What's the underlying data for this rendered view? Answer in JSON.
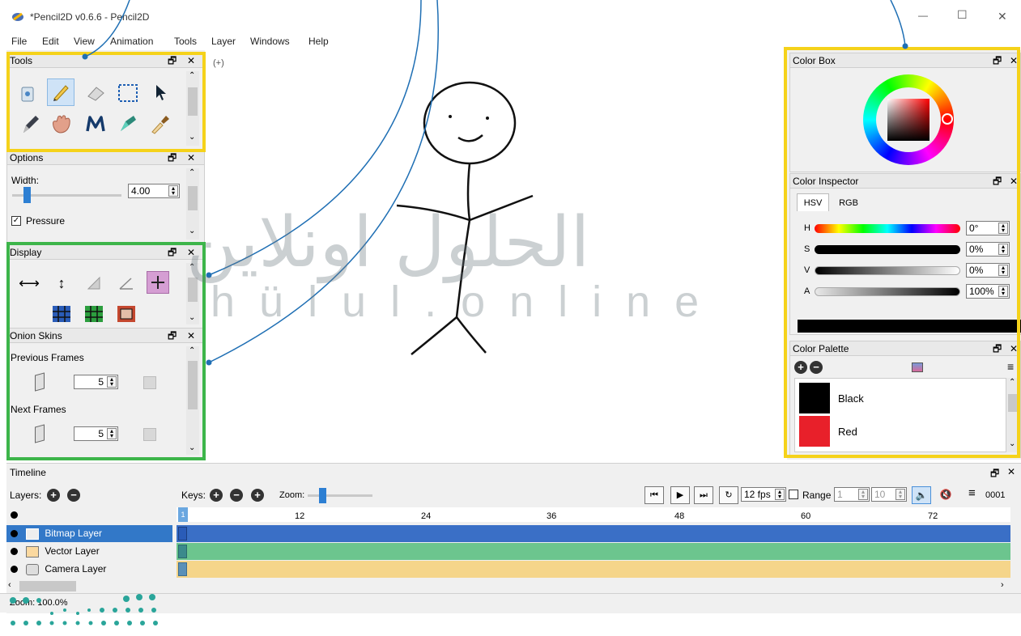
{
  "window": {
    "title": "*Pencil2D v0.6.6 - Pencil2D",
    "min_glyph": "—",
    "max_glyph": "☐",
    "close_glyph": "✕"
  },
  "menu": [
    "File",
    "Edit",
    "View",
    "Animation",
    "Tools",
    "Layer",
    "Windows",
    "Help"
  ],
  "tools_panel": {
    "title": "Tools",
    "icons": [
      "clear-icon",
      "pencil-icon",
      "eraser-icon",
      "select-icon",
      "move-icon",
      "pen-icon",
      "hand-icon",
      "polyline-icon",
      "bucket-icon",
      "eyedropper-icon"
    ]
  },
  "options_panel": {
    "title": "Options",
    "width_label": "Width:",
    "width_value": "4.00",
    "pressure_label": "Pressure",
    "pressure_checked": true
  },
  "display_panel": {
    "title": "Display",
    "icons": [
      "flip-horizontal-icon",
      "flip-vertical-icon",
      "overlay-icon",
      "angle-icon",
      "center-cross-icon",
      "grid-blue-icon",
      "grid-green-icon",
      "frame-icon"
    ]
  },
  "onion_panel": {
    "title": "Onion Skins",
    "previous_label": "Previous Frames",
    "previous_value": "5",
    "next_label": "Next Frames",
    "next_value": "5"
  },
  "color_box": {
    "title": "Color Box"
  },
  "color_inspector": {
    "title": "Color Inspector",
    "tabs": [
      "HSV",
      "RGB"
    ],
    "rows": [
      {
        "label": "H",
        "value": "0°"
      },
      {
        "label": "S",
        "value": "0%"
      },
      {
        "label": "V",
        "value": "0%"
      },
      {
        "label": "A",
        "value": "100%"
      }
    ]
  },
  "color_palette": {
    "title": "Color Palette",
    "swatches": [
      {
        "name": "Black",
        "color": "#000000"
      },
      {
        "name": "Red",
        "color": "#e8202a"
      }
    ]
  },
  "timeline": {
    "title": "Timeline",
    "layers_label": "Layers:",
    "keys_label": "Keys:",
    "zoom_label": "Zoom:",
    "fps": "12 fps",
    "range_label": "Range",
    "range_start": "1",
    "range_end": "10",
    "frame_counter": "0001",
    "ticks": [
      "12",
      "24",
      "36",
      "48",
      "60",
      "72"
    ],
    "first_frame": "1",
    "layers": [
      {
        "name": "Bitmap Layer",
        "selected": true,
        "track_color": "#3a6fc6"
      },
      {
        "name": "Vector Layer",
        "selected": false,
        "track_color": "#6cc58e"
      },
      {
        "name": "Camera Layer",
        "selected": false,
        "track_color": "#f5d58a"
      }
    ]
  },
  "status": {
    "zoom": "Zoom: 100.0%"
  },
  "watermark": {
    "arabic": "الحلول اونلاين",
    "latin": "hülul.online"
  },
  "colors": {
    "highlight_yellow": "#f5d21a",
    "highlight_green": "#3db54a",
    "callout_line": "#1f6fb4",
    "selection_blue": "#3278c8"
  }
}
